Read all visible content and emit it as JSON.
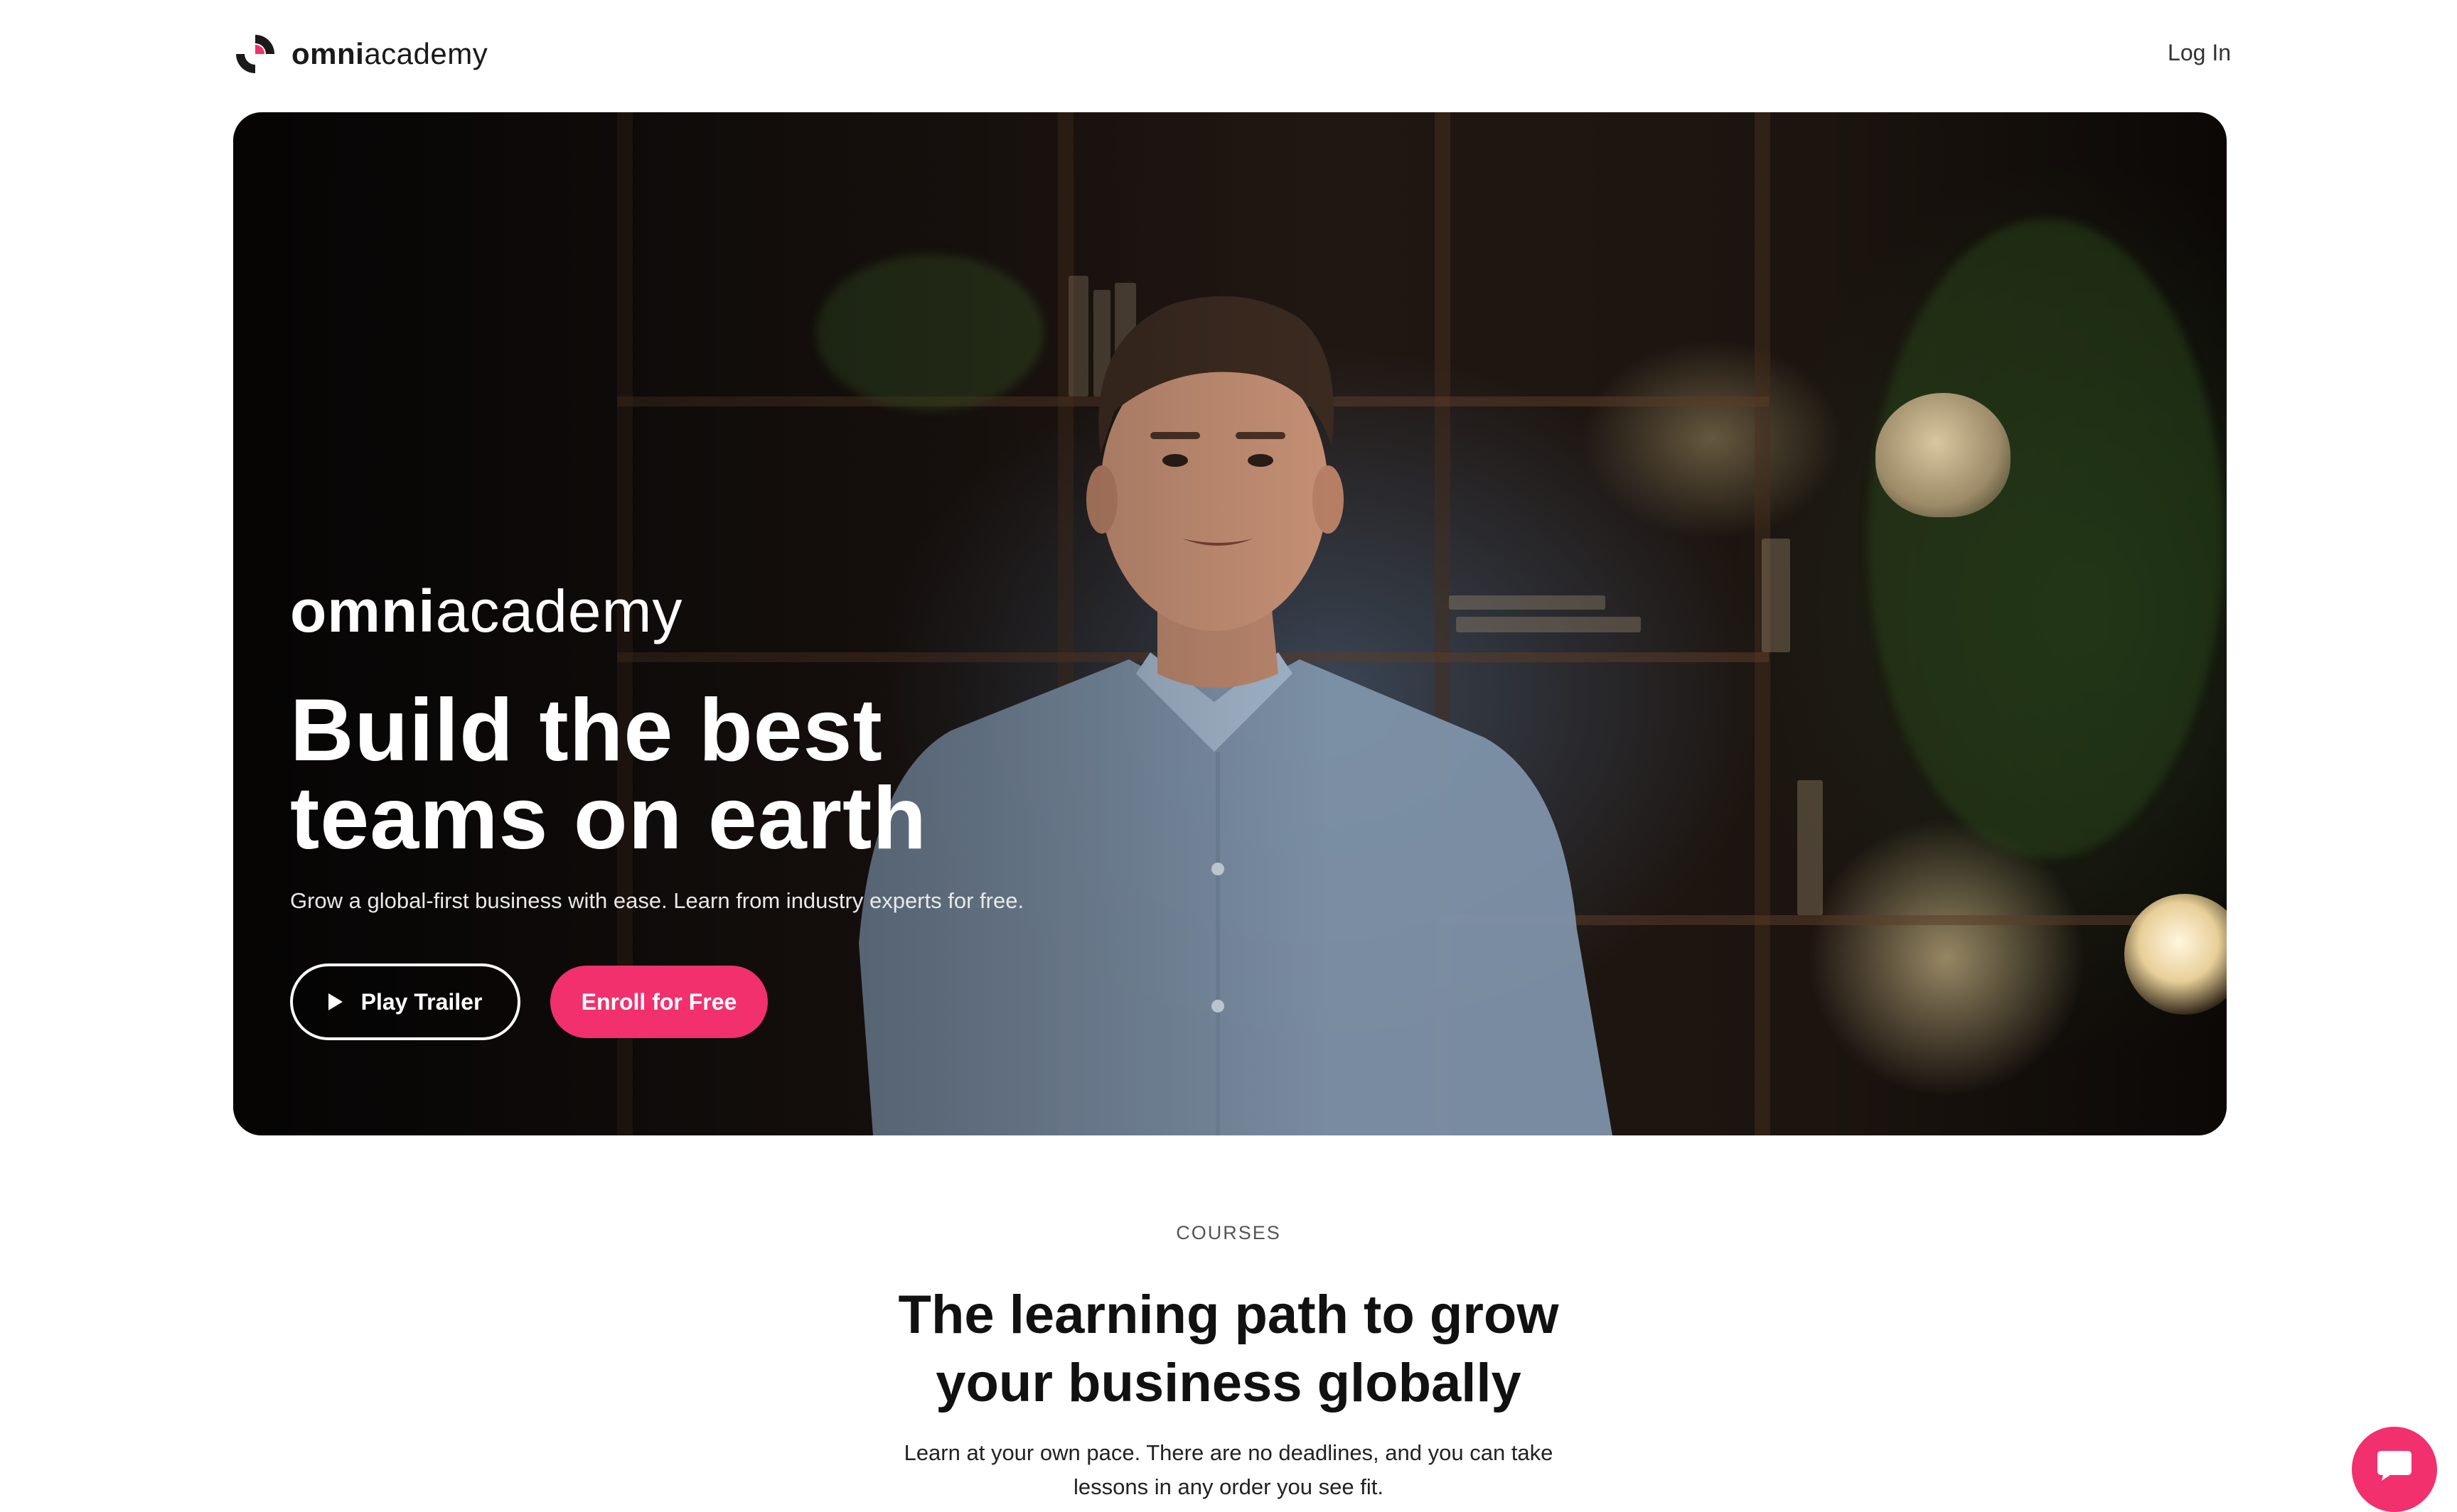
{
  "header": {
    "brand_bold": "omni",
    "brand_light": "academy",
    "login_label": "Log In"
  },
  "hero": {
    "logo_bold": "omni",
    "logo_light": "academy",
    "title": "Build the best teams on earth",
    "subtitle": "Grow a global-first business with ease. Learn from industry experts for free.",
    "trailer_label": "Play Trailer",
    "enroll_label": "Enroll for Free"
  },
  "courses": {
    "eyebrow": "COURSES",
    "title": "The learning path to grow your business globally",
    "description": "Learn at your own pace. There are no deadlines, and you can take lessons in any order you see fit."
  },
  "icons": {
    "brand": "omni-logo-icon",
    "play": "play-icon",
    "chat": "chat-icon"
  },
  "colors": {
    "accent": "#f2306e",
    "text": "#111111",
    "background": "#ffffff"
  }
}
